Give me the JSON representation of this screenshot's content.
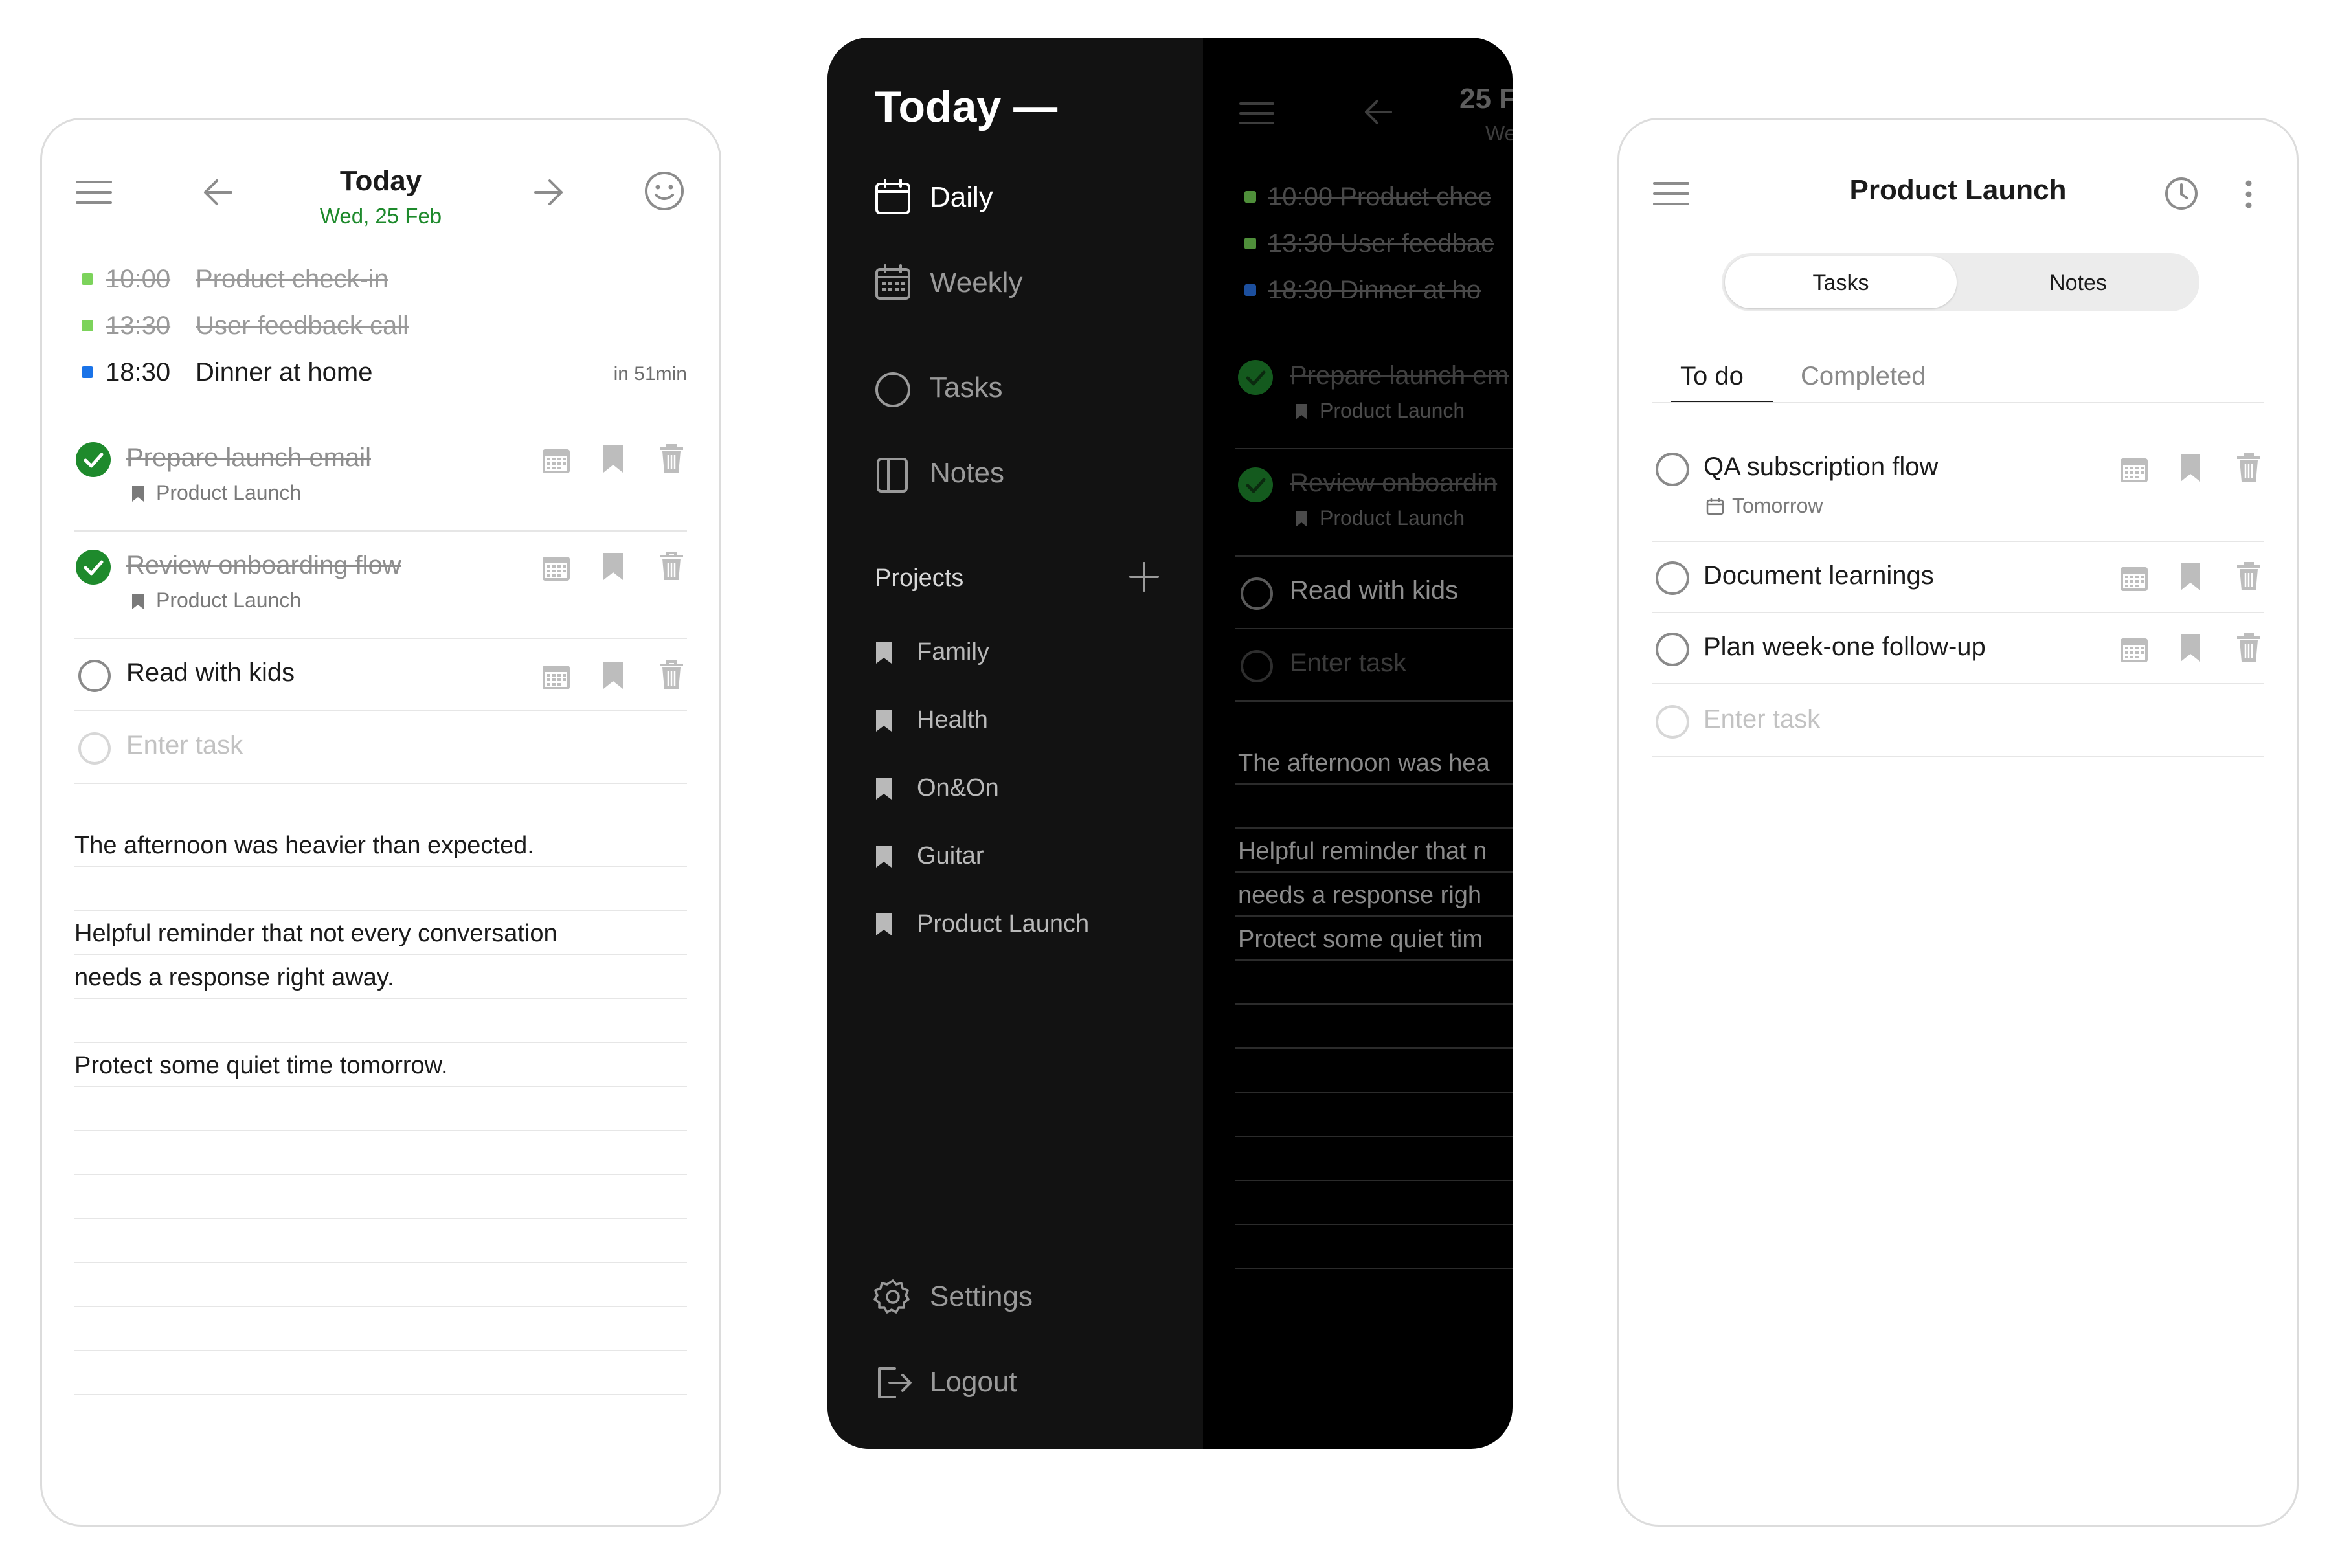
{
  "left": {
    "header_title": "Today",
    "header_date": "Wed, 25 Feb",
    "events": [
      {
        "time": "10:00",
        "title": "Product check-in",
        "done": true,
        "color": "#7cd35b"
      },
      {
        "time": "13:30",
        "title": "User feedback call",
        "done": true,
        "color": "#7cd35b"
      },
      {
        "time": "18:30",
        "title": "Dinner at home",
        "done": false,
        "color": "#1a73e8",
        "eta": "in 51min"
      }
    ],
    "tasks": [
      {
        "title": "Prepare launch email",
        "project": "Product Launch",
        "done": true
      },
      {
        "title": "Review onboarding flow",
        "project": "Product Launch",
        "done": true
      },
      {
        "title": "Read with kids",
        "done": false
      }
    ],
    "enter_task_placeholder": "Enter task",
    "notes": [
      "The afternoon was heavier than expected.",
      "Helpful reminder that not every conversation",
      "needs a response right away.",
      "Protect some quiet time tomorrow."
    ]
  },
  "menu": {
    "title": "Today —",
    "nav": [
      {
        "label": "Daily",
        "icon": "calendar-icon"
      },
      {
        "label": "Weekly",
        "icon": "calendar-grid-icon"
      },
      {
        "label": "Tasks",
        "icon": "circle-icon"
      },
      {
        "label": "Notes",
        "icon": "notebook-icon"
      }
    ],
    "projects_heading": "Projects",
    "projects": [
      "Family",
      "Health",
      "On&On",
      "Guitar",
      "Product Launch"
    ],
    "settings_label": "Settings",
    "logout_label": "Logout",
    "peek": {
      "date": "25 F",
      "weekday": "We",
      "events": [
        "10:00  Product chec",
        "13:30  User feedbac",
        "18:30  Dinner at ho"
      ],
      "event_colors": [
        "#7cd35b",
        "#7cd35b",
        "#1a73e8"
      ],
      "tasks": [
        {
          "title": "Prepare launch em",
          "project": "Product Launch",
          "done": true
        },
        {
          "title": "Review onboardin",
          "project": "Product Launch",
          "done": true
        },
        {
          "title": "Read with kids",
          "done": false
        }
      ],
      "enter_task": "Enter task",
      "notes": [
        "The afternoon was hea",
        "Helpful reminder that n",
        "needs a response righ",
        "Protect some quiet tim"
      ]
    }
  },
  "right": {
    "title": "Product Launch",
    "segment_tasks": "Tasks",
    "segment_notes": "Notes",
    "tab_todo": "To do",
    "tab_completed": "Completed",
    "tasks": [
      {
        "title": "QA subscription flow",
        "due": "Tomorrow"
      },
      {
        "title": "Document learnings"
      },
      {
        "title": "Plan week-one follow-up"
      }
    ],
    "enter_task_placeholder": "Enter task"
  }
}
